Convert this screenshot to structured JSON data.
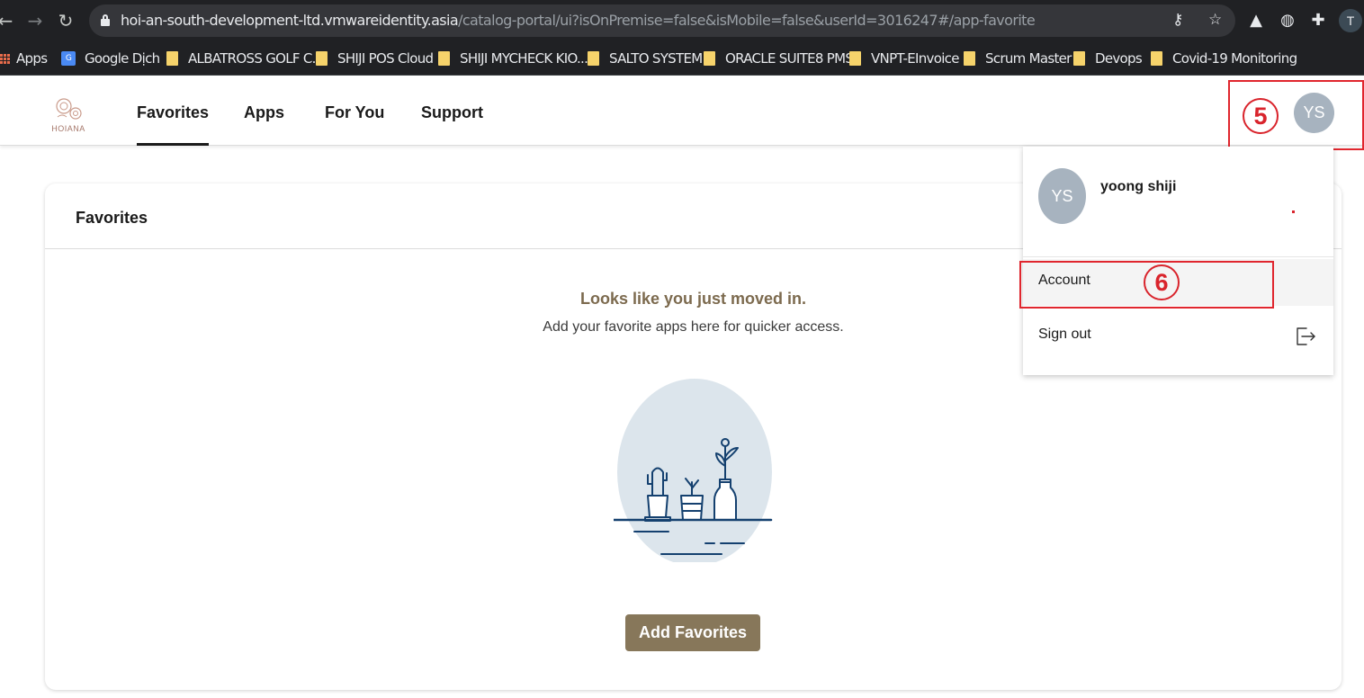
{
  "browser": {
    "url_host": "hoi-an-south-development-ltd.vmwareidentity.asia",
    "url_path": "/catalog-portal/ui?isOnPremise=false&isMobile=false&userId=3016247#/app-favorite",
    "profile_initial": "T",
    "bookmarks": [
      {
        "label": "Apps",
        "icon": "apps-grid-icon"
      },
      {
        "label": "Google Dịch",
        "icon": "google-translate-icon"
      },
      {
        "label": "ALBATROSS GOLF C...",
        "icon": "folder-icon"
      },
      {
        "label": "SHIJI POS Cloud",
        "icon": "folder-icon"
      },
      {
        "label": "SHIJI MYCHECK KIO...",
        "icon": "folder-icon"
      },
      {
        "label": "SALTO SYSTEM",
        "icon": "folder-icon"
      },
      {
        "label": "ORACLE SUITE8 PMS",
        "icon": "folder-icon"
      },
      {
        "label": "VNPT-EInvoice",
        "icon": "folder-icon"
      },
      {
        "label": "Scrum Master",
        "icon": "folder-icon"
      },
      {
        "label": "Devops",
        "icon": "folder-icon"
      },
      {
        "label": "Covid-19 Monitoring",
        "icon": "folder-icon"
      }
    ]
  },
  "header": {
    "logo_text": "HOIANA",
    "tabs": [
      {
        "label": "Favorites",
        "active": true
      },
      {
        "label": "Apps",
        "active": false
      },
      {
        "label": "For You",
        "active": false
      },
      {
        "label": "Support",
        "active": false
      }
    ],
    "avatar_initials": "YS"
  },
  "annotations": {
    "step5": "5",
    "step6": "6",
    "color": "#e0262e"
  },
  "card": {
    "title": "Favorites",
    "empty_title": "Looks like you just moved in.",
    "empty_subtitle": "Add your favorite apps here for quicker access.",
    "add_button": "Add Favorites"
  },
  "dropdown": {
    "avatar_initials": "YS",
    "user_name": "yoong shiji",
    "items": [
      {
        "label": "Account",
        "icon": ""
      },
      {
        "label": "Sign out",
        "icon": "sign-out-icon"
      }
    ]
  },
  "colors": {
    "accent": "#87775a",
    "heading_brown": "#7c6a4e",
    "avatar": "#a7b3bf",
    "illustration_navy": "#14406f",
    "illustration_bg": "#dce5ec"
  }
}
